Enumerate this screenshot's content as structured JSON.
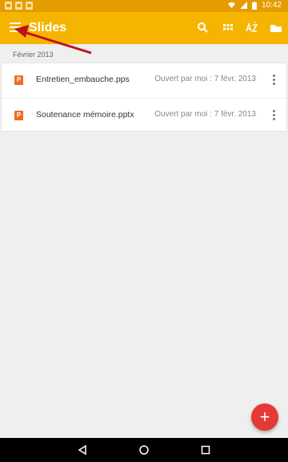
{
  "status_bar": {
    "time": "10:42"
  },
  "app_bar": {
    "title": "Slides"
  },
  "section": {
    "label": "Février 2013"
  },
  "files": [
    {
      "name": "Entretien_embauche.pps",
      "meta": "Ouvert par moi : 7 févr. 2013",
      "icon_letter": "P"
    },
    {
      "name": "Soutenance mémoire.pptx",
      "meta": "Ouvert par moi : 7 févr. 2013",
      "icon_letter": "P"
    }
  ],
  "fab": {
    "label": "+"
  },
  "colors": {
    "appbar": "#f5b400",
    "statusbar": "#e59c00",
    "fab": "#e53935",
    "annotation_arrow": "#c0111b"
  }
}
